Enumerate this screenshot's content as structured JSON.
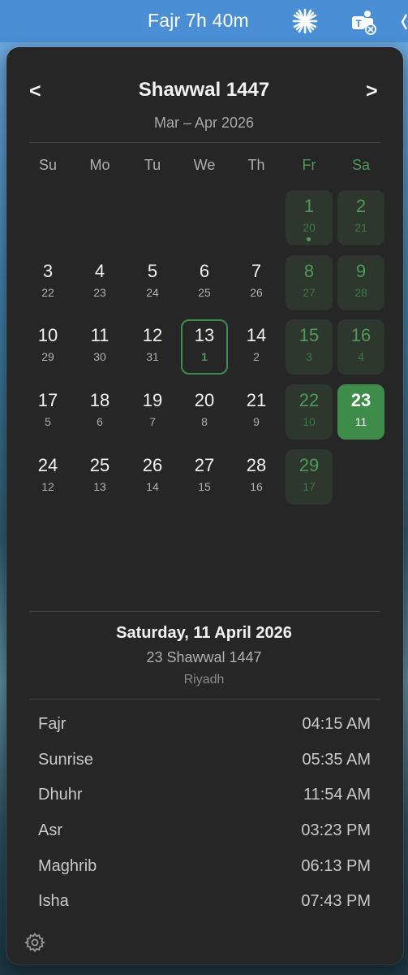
{
  "menubar": {
    "title": "Fajr 7h 40m",
    "icons": [
      "sparkle-icon",
      "teams-icon"
    ]
  },
  "calendar": {
    "prev_label": "<",
    "next_label": ">",
    "month": "Shawwal 1447",
    "gregorian_range": "Mar – Apr 2026",
    "weekdays": [
      "Su",
      "Mo",
      "Tu",
      "We",
      "Th",
      "Fr",
      "Sa"
    ],
    "weeks": [
      [
        null,
        null,
        null,
        null,
        null,
        {
          "h": "1",
          "g": "20",
          "dot": true
        },
        {
          "h": "2",
          "g": "21"
        }
      ],
      [
        {
          "h": "3",
          "g": "22"
        },
        {
          "h": "4",
          "g": "23"
        },
        {
          "h": "5",
          "g": "24"
        },
        {
          "h": "6",
          "g": "25"
        },
        {
          "h": "7",
          "g": "26"
        },
        {
          "h": "8",
          "g": "27"
        },
        {
          "h": "9",
          "g": "28"
        }
      ],
      [
        {
          "h": "10",
          "g": "29"
        },
        {
          "h": "11",
          "g": "30"
        },
        {
          "h": "12",
          "g": "31"
        },
        {
          "h": "13",
          "g": "1",
          "today": true
        },
        {
          "h": "14",
          "g": "2"
        },
        {
          "h": "15",
          "g": "3"
        },
        {
          "h": "16",
          "g": "4"
        }
      ],
      [
        {
          "h": "17",
          "g": "5"
        },
        {
          "h": "18",
          "g": "6"
        },
        {
          "h": "19",
          "g": "7"
        },
        {
          "h": "20",
          "g": "8"
        },
        {
          "h": "21",
          "g": "9"
        },
        {
          "h": "22",
          "g": "10"
        },
        {
          "h": "23",
          "g": "11",
          "selected": true
        }
      ],
      [
        {
          "h": "24",
          "g": "12"
        },
        {
          "h": "25",
          "g": "13"
        },
        {
          "h": "26",
          "g": "14"
        },
        {
          "h": "27",
          "g": "15"
        },
        {
          "h": "28",
          "g": "16"
        },
        {
          "h": "29",
          "g": "17"
        },
        null
      ]
    ]
  },
  "detail": {
    "date": "Saturday, 11 April 2026",
    "hijri": "23 Shawwal 1447",
    "city": "Riyadh"
  },
  "prayers": [
    {
      "name": "Fajr",
      "time": "04:15 AM"
    },
    {
      "name": "Sunrise",
      "time": "05:35 AM"
    },
    {
      "name": "Dhuhr",
      "time": "11:54 AM"
    },
    {
      "name": "Asr",
      "time": "03:23 PM"
    },
    {
      "name": "Maghrib",
      "time": "06:13 PM"
    },
    {
      "name": "Isha",
      "time": "07:43 PM"
    }
  ],
  "colors": {
    "accent": "#3e8c4a",
    "weekend_text": "#4e9a58",
    "popover_bg": "#262626",
    "menubar_bg": "#4a8fd6"
  },
  "footer": {
    "icon": "gear-icon"
  }
}
